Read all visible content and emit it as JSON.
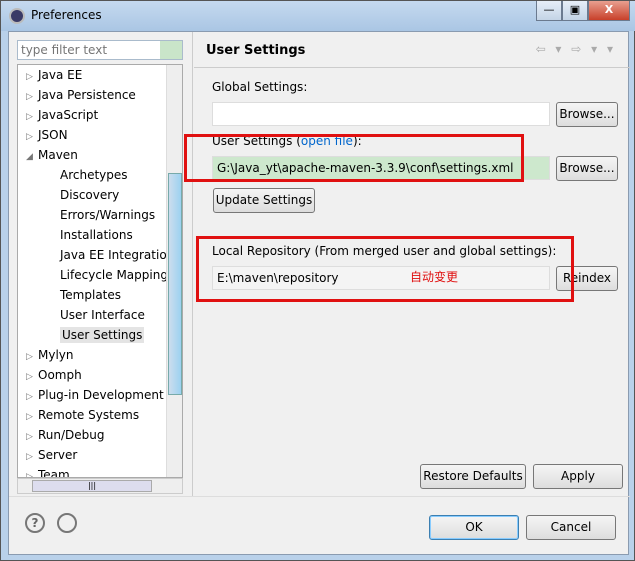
{
  "window": {
    "title": "Preferences",
    "minimize": "—",
    "maximize": "▣",
    "close": "X"
  },
  "filter": {
    "placeholder": "type filter text"
  },
  "tree": [
    {
      "label": "Java EE",
      "level": 0,
      "arrow": "▷"
    },
    {
      "label": "Java Persistence",
      "level": 0,
      "arrow": "▷"
    },
    {
      "label": "JavaScript",
      "level": 0,
      "arrow": "▷"
    },
    {
      "label": "JSON",
      "level": 0,
      "arrow": "▷"
    },
    {
      "label": "Maven",
      "level": 0,
      "arrow": "◢"
    },
    {
      "label": "Archetypes",
      "level": 1
    },
    {
      "label": "Discovery",
      "level": 1
    },
    {
      "label": "Errors/Warnings",
      "level": 1
    },
    {
      "label": "Installations",
      "level": 1
    },
    {
      "label": "Java EE Integration",
      "level": 1
    },
    {
      "label": "Lifecycle Mappings",
      "level": 1
    },
    {
      "label": "Templates",
      "level": 1
    },
    {
      "label": "User Interface",
      "level": 1
    },
    {
      "label": "User Settings",
      "level": 1,
      "selected": true
    },
    {
      "label": "Mylyn",
      "level": 0,
      "arrow": "▷"
    },
    {
      "label": "Oomph",
      "level": 0,
      "arrow": "▷"
    },
    {
      "label": "Plug-in Development",
      "level": 0,
      "arrow": "▷"
    },
    {
      "label": "Remote Systems",
      "level": 0,
      "arrow": "▷"
    },
    {
      "label": "Run/Debug",
      "level": 0,
      "arrow": "▷"
    },
    {
      "label": "Server",
      "level": 0,
      "arrow": "▷"
    },
    {
      "label": "Team",
      "level": 0,
      "arrow": "▷"
    }
  ],
  "page": {
    "title": "User Settings",
    "nav": "⇦ ▾ ⇨ ▾ ▾",
    "global_label": "Global Settings:",
    "global_value": "",
    "browse": "Browse...",
    "user_label_pre": "User Settings (",
    "user_link": "open file",
    "user_label_post": "):",
    "user_value": "G:\\Java_yt\\apache-maven-3.3.9\\conf\\settings.xml",
    "update": "Update Settings",
    "local_label": "Local Repository (From merged user and global settings):",
    "local_value": "E:\\maven\\repository",
    "annotation": "自动变更",
    "reindex": "Reindex",
    "restore": "Restore Defaults",
    "apply": "Apply"
  },
  "footer": {
    "help": "?",
    "ok": "OK",
    "cancel": "Cancel"
  },
  "colors": {
    "highlight": "#e01010",
    "link": "#0066cc"
  }
}
